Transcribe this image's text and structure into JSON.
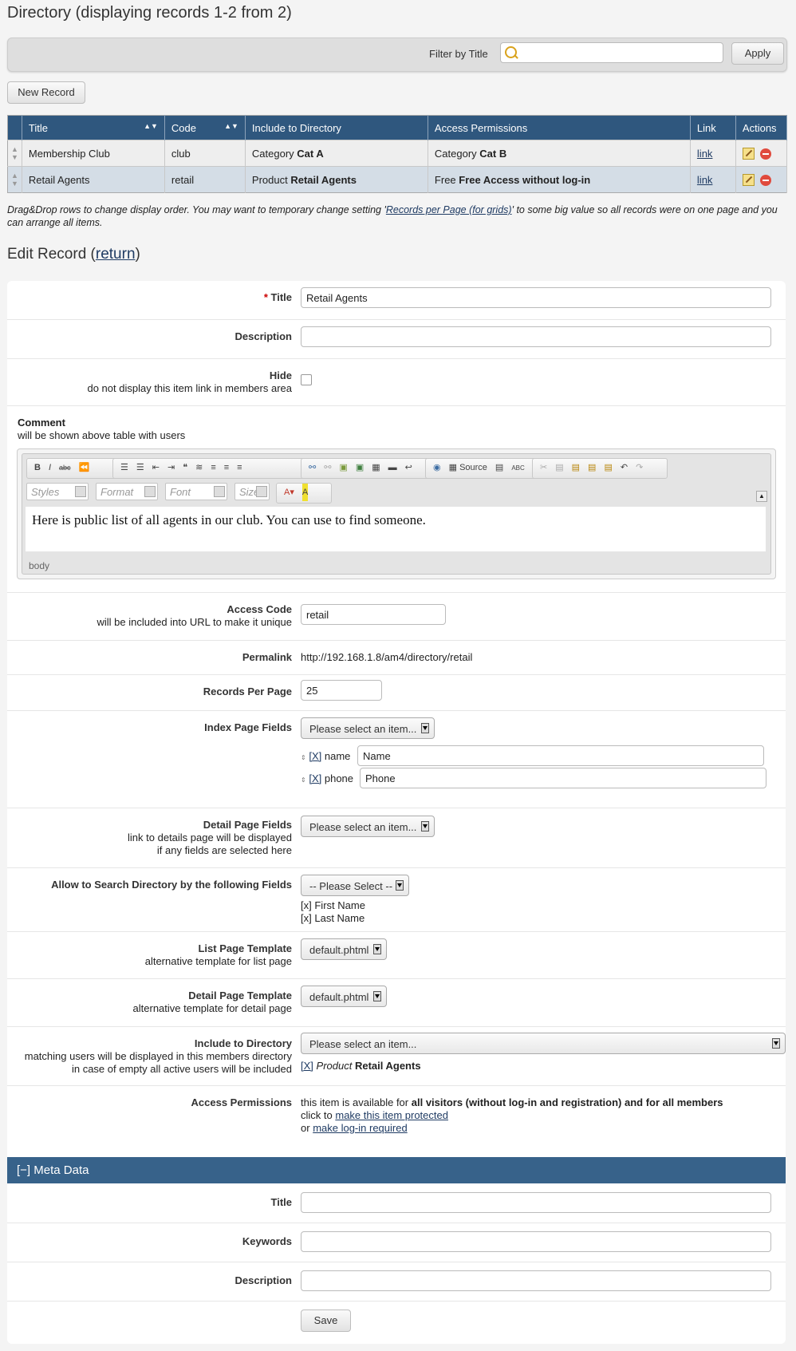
{
  "page_title": "Directory (displaying records 1-2 from 2)",
  "filter": {
    "label": "Filter by Title",
    "value": "",
    "apply": "Apply"
  },
  "new_record": "New Record",
  "grid": {
    "headers": [
      "Title",
      "Code",
      "Include to Directory",
      "Access Permissions",
      "Link",
      "Actions"
    ],
    "rows": [
      {
        "title": "Membership Club",
        "code": "club",
        "include_prefix": "Category",
        "include_name": "Cat A",
        "access_prefix": "Category",
        "access_name": "Cat B",
        "link": "link"
      },
      {
        "title": "Retail Agents",
        "code": "retail",
        "include_prefix": "Product",
        "include_name": "Retail Agents",
        "access_prefix": "Free",
        "access_name": "Free Access without log-in",
        "link": "link"
      }
    ]
  },
  "note": {
    "before": "Drag&Drop rows to change display order. You may want to temporary change setting '",
    "link": "Records per Page (for grids)",
    "after": "' to some big value so all records were on one page and you can arrange all items."
  },
  "edit": {
    "heading_prefix": "Edit Record (",
    "return": "return",
    "heading_suffix": ")"
  },
  "form": {
    "title": {
      "label": "Title",
      "required": "*",
      "value": "Retail Agents"
    },
    "description": {
      "label": "Description",
      "value": ""
    },
    "hide": {
      "label": "Hide",
      "sub": "do not display this item link in members area"
    },
    "comment": {
      "label": "Comment",
      "sub": "will be shown above table with users",
      "content": "Here is public list of all agents in our club. You can use to find someone.",
      "path": "body",
      "toolbar_source": "Source",
      "styles": "Styles",
      "format": "Format",
      "font": "Font",
      "size": "Size"
    },
    "access_code": {
      "label": "Access Code",
      "sub": "will be included into URL to make it unique",
      "value": "retail"
    },
    "permalink": {
      "label": "Permalink",
      "value": "http://192.168.1.8/am4/directory/retail"
    },
    "records_per_page": {
      "label": "Records Per Page",
      "value": "25"
    },
    "index_fields": {
      "label": "Index Page Fields",
      "select": "Please select an item...",
      "items": [
        {
          "remove": "[X]",
          "name": "name",
          "value": "Name"
        },
        {
          "remove": "[X]",
          "name": "phone",
          "value": "Phone"
        }
      ]
    },
    "detail_fields": {
      "label": "Detail Page Fields",
      "sub1": "link to details page will be displayed",
      "sub2": "if any fields are selected here",
      "select": "Please select an item..."
    },
    "search_fields": {
      "label": "Allow to Search Directory by the following Fields",
      "select": "-- Please Select --",
      "items": [
        {
          "remove": "[x]",
          "name": "First Name"
        },
        {
          "remove": "[x]",
          "name": "Last Name"
        }
      ]
    },
    "list_template": {
      "label": "List Page Template",
      "sub": "alternative template for list page",
      "value": "default.phtml"
    },
    "detail_template": {
      "label": "Detail Page Template",
      "sub": "alternative template for detail page",
      "value": "default.phtml"
    },
    "include_dir": {
      "label": "Include to Directory",
      "sub1": "matching users will be displayed in this members directory",
      "sub2": "in case of empty all active users will be included",
      "select": "Please select an item...",
      "remove": "[X]",
      "item_type": "Product",
      "item_name": "Retail Agents"
    },
    "access": {
      "label": "Access Permissions",
      "line1_prefix": "this item is available for",
      "line1_bold": "all visitors (without log-in and registration) and for all members",
      "line2_prefix": "click to",
      "line2_link": "make this item protected",
      "line3_prefix": "or",
      "line3_link": "make log-in required"
    },
    "meta": {
      "toggle": "[−]",
      "title": "Meta Data",
      "title_label": "Title",
      "keywords_label": "Keywords",
      "description_label": "Description"
    },
    "save": "Save"
  }
}
